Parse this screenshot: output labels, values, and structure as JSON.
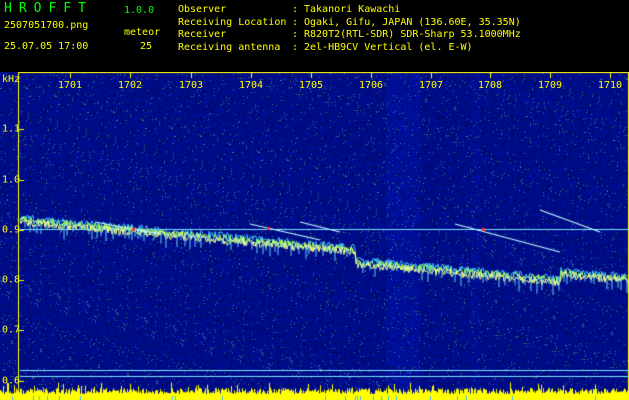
{
  "app": {
    "name": "HROFFT",
    "version": "1.0.0"
  },
  "file": {
    "name": "2507051700.png",
    "datetime": "25.07.05 17:00"
  },
  "meteor": {
    "label": "meteor",
    "count": "25"
  },
  "info": [
    {
      "label": "Observer",
      "value": "Takanori Kawachi"
    },
    {
      "label": "Receiving Location",
      "value": "Ogaki, Gifu, JAPAN (136.60E, 35.35N)"
    },
    {
      "label": "Receiver",
      "value": "R820T2(RTL-SDR) SDR-Sharp 53.1000MHz"
    },
    {
      "label": "Receiving antenna",
      "value": "2el-HB9CV Vertical (el. E-W)"
    }
  ],
  "axis": {
    "y_unit": "kHz",
    "x_ticks": [
      "1701",
      "1702",
      "1703",
      "1704",
      "1705",
      "1706",
      "1707",
      "1708",
      "1709",
      "1710"
    ],
    "y_ticks": [
      "1.1",
      "1.0",
      "0.9",
      "0.8",
      "0.7",
      "0.6"
    ]
  },
  "colors": {
    "text": "#ffff00",
    "accent": "#00ff00",
    "background": "#000000"
  }
}
